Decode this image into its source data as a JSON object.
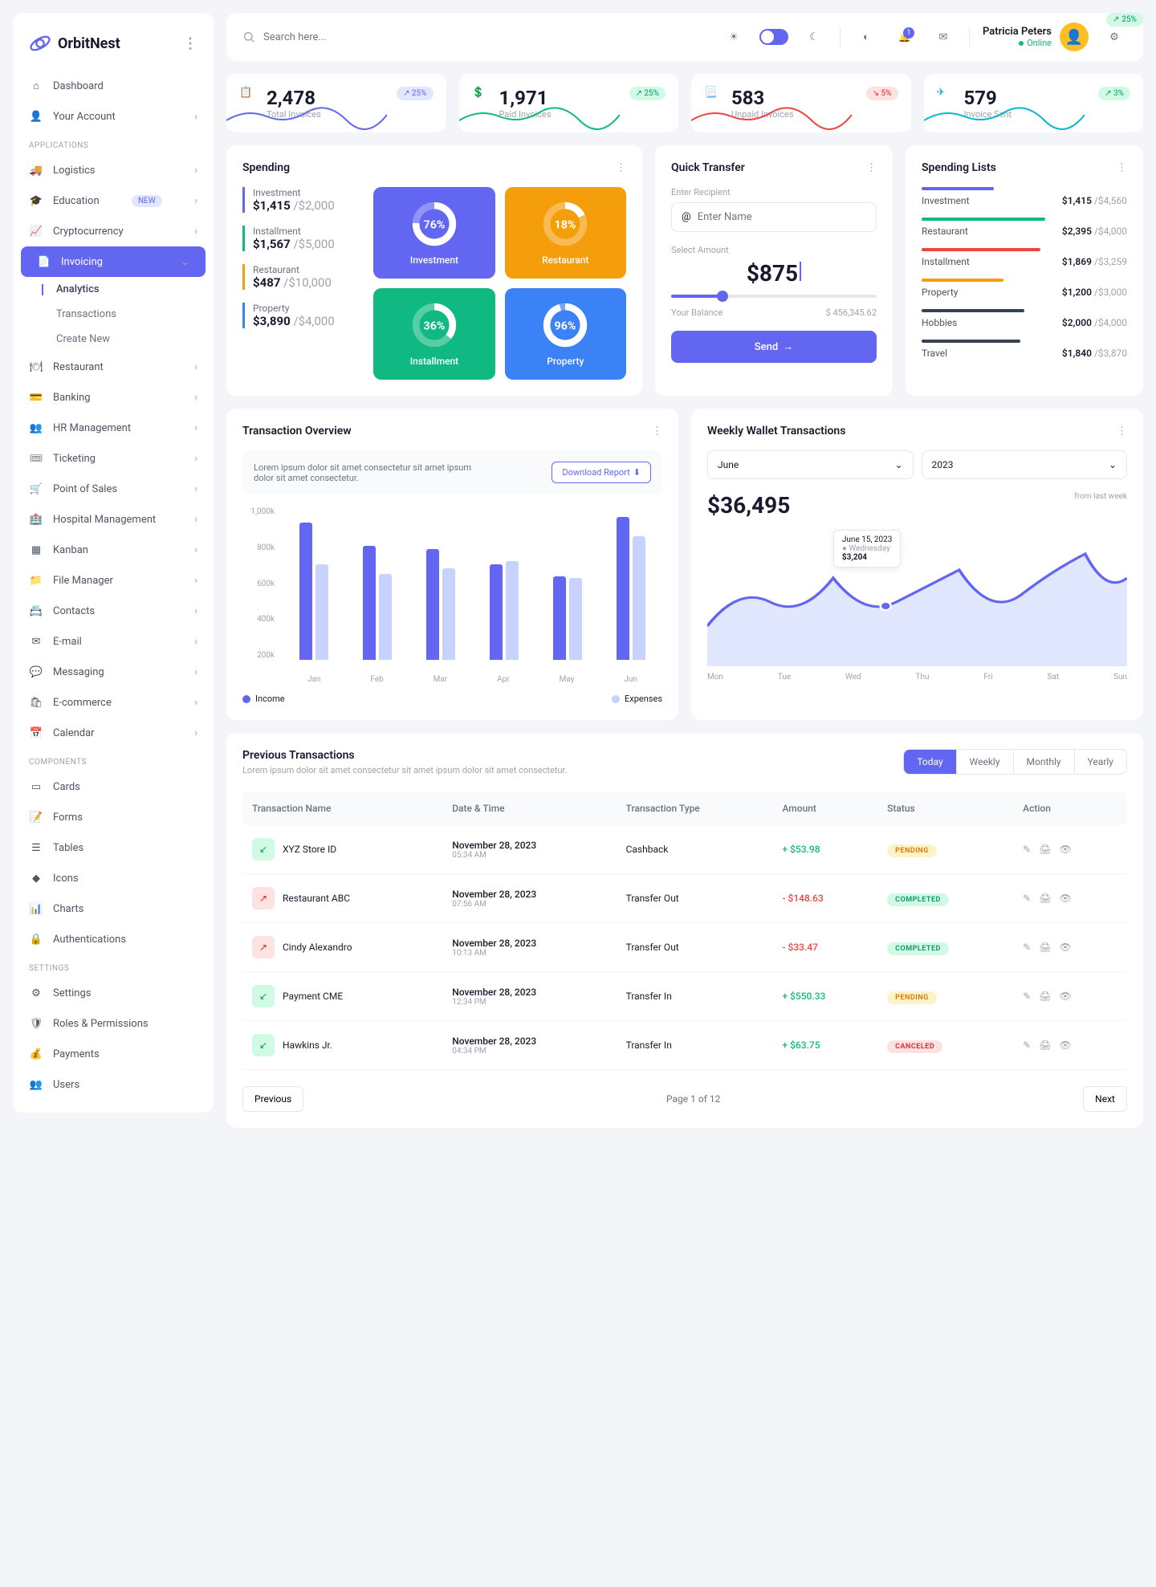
{
  "brand": "OrbitNest",
  "search": {
    "placeholder": "Search here..."
  },
  "user": {
    "name": "Patricia Peters",
    "status": "Online"
  },
  "notif_count": "1",
  "sections": {
    "main": [
      {
        "label": "Dashboard"
      },
      {
        "label": "Your Account"
      }
    ],
    "apps_label": "APPLICATIONS",
    "apps": [
      {
        "label": "Logistics"
      },
      {
        "label": "Education",
        "badge": "NEW"
      },
      {
        "label": "Cryptocurrency"
      },
      {
        "label": "Invoicing",
        "active": true
      },
      {
        "label": "Restaurant"
      },
      {
        "label": "Banking"
      },
      {
        "label": "HR Management"
      },
      {
        "label": "Ticketing"
      },
      {
        "label": "Point of Sales"
      },
      {
        "label": "Hospital Management"
      },
      {
        "label": "Kanban"
      },
      {
        "label": "File Manager"
      },
      {
        "label": "Contacts"
      },
      {
        "label": "E-mail"
      },
      {
        "label": "Messaging"
      },
      {
        "label": "E-commerce"
      },
      {
        "label": "Calendar"
      }
    ],
    "invoicing_sub": [
      {
        "label": "Analytics",
        "active": true
      },
      {
        "label": "Transactions"
      },
      {
        "label": "Create New"
      }
    ],
    "components_label": "COMPONENTS",
    "components": [
      {
        "label": "Cards"
      },
      {
        "label": "Forms"
      },
      {
        "label": "Tables"
      },
      {
        "label": "Icons"
      },
      {
        "label": "Charts"
      },
      {
        "label": "Authentications"
      }
    ],
    "settings_label": "SETTINGS",
    "settings": [
      {
        "label": "Settings"
      },
      {
        "label": "Roles & Permissions"
      },
      {
        "label": "Payments"
      },
      {
        "label": "Users"
      }
    ]
  },
  "stats": [
    {
      "value": "2,478",
      "label": "Total Invoices",
      "badge": "25%",
      "dir": "info",
      "color": "#6366f1"
    },
    {
      "value": "1,971",
      "label": "Paid Invoices",
      "badge": "25%",
      "dir": "up",
      "color": "#10b981"
    },
    {
      "value": "583",
      "label": "Unpaid Invoices",
      "badge": "5%",
      "dir": "down",
      "color": "#ef4444"
    },
    {
      "value": "579",
      "label": "Invoice Sent",
      "badge": "3%",
      "dir": "up",
      "color": "#06b6d4"
    }
  ],
  "spending": {
    "title": "Spending",
    "items": [
      {
        "label": "Investment",
        "val": "$1,415",
        "max": "/$2,000",
        "pct": "76%"
      },
      {
        "label": "Installment",
        "val": "$1,567",
        "max": "/$5,000",
        "pct": "36%"
      },
      {
        "label": "Restaurant",
        "val": "$487",
        "max": "/$10,000",
        "pct": "18%"
      },
      {
        "label": "Property",
        "val": "$3,890",
        "max": "/$4,000",
        "pct": "96%"
      }
    ]
  },
  "quick_transfer": {
    "title": "Quick Transfer",
    "recipient_label": "Enter Recipient",
    "recipient_placeholder": "Enter Name",
    "amount_label": "Select Amount",
    "amount": "$875",
    "balance_label": "Your Balance",
    "balance": "$ 456,345.62",
    "send": "Send"
  },
  "spending_lists": {
    "title": "Spending Lists",
    "items": [
      {
        "name": "Investment",
        "val": "$1,415",
        "max": "/$4,560",
        "color": "#6366f1",
        "w": "35%"
      },
      {
        "name": "Restaurant",
        "val": "$2,395",
        "max": "/$4,000",
        "color": "#10b981",
        "w": "60%"
      },
      {
        "name": "Installment",
        "val": "$1,869",
        "max": "/$3,259",
        "color": "#ef4444",
        "w": "58%"
      },
      {
        "name": "Property",
        "val": "$1,200",
        "max": "/$3,000",
        "color": "#f59e0b",
        "w": "40%"
      },
      {
        "name": "Hobbies",
        "val": "$2,000",
        "max": "/$4,000",
        "color": "#374151",
        "w": "50%"
      },
      {
        "name": "Travel",
        "val": "$1,840",
        "max": "/$3,870",
        "color": "#374151",
        "w": "48%"
      }
    ]
  },
  "transaction_overview": {
    "title": "Transaction Overview",
    "note": "Lorem ipsum dolor sit amet consectetur sit amet ipsum dolor sit amet consectetur.",
    "download": "Download Report",
    "legend_income": "Income",
    "legend_expense": "Expenses"
  },
  "weekly_wallet": {
    "title": "Weekly Wallet Transactions",
    "month": "June",
    "year": "2023",
    "amount": "$36,495",
    "badge": "25%",
    "sub": "from last week",
    "tooltip_date": "June 15, 2023",
    "tooltip_day": "Wednesday",
    "tooltip_val": "$3,204",
    "days": [
      "Mon",
      "Tue",
      "Wed",
      "Thu",
      "Fri",
      "Sat",
      "Sun"
    ]
  },
  "previous_transactions": {
    "title": "Previous Transactions",
    "sub": "Lorem ipsum dolor sit amet consectetur sit amet ipsum dolor sit amet consectetur.",
    "tabs": [
      "Today",
      "Weekly",
      "Monthly",
      "Yearly"
    ],
    "headers": [
      "Transaction Name",
      "Date & Time",
      "Transaction Type",
      "Amount",
      "Status",
      "Action"
    ],
    "rows": [
      {
        "icon": "in",
        "name": "XYZ Store ID",
        "date": "November 28, 2023",
        "time": "05:34 AM",
        "type": "Cashback",
        "amount": "+ $53.98",
        "amt_class": "pos",
        "status": "PENDING",
        "status_class": "pending"
      },
      {
        "icon": "out",
        "name": "Restaurant ABC",
        "date": "November 28, 2023",
        "time": "07:56 AM",
        "type": "Transfer Out",
        "amount": "- $148.63",
        "amt_class": "neg",
        "status": "COMPLETED",
        "status_class": "completed"
      },
      {
        "icon": "out",
        "name": "Cindy Alexandro",
        "date": "November 28, 2023",
        "time": "10:13 AM",
        "type": "Transfer Out",
        "amount": "- $33.47",
        "amt_class": "neg",
        "status": "COMPLETED",
        "status_class": "completed"
      },
      {
        "icon": "in",
        "name": "Payment CME",
        "date": "November 28, 2023",
        "time": "12:34 PM",
        "type": "Transfer In",
        "amount": "+ $550.33",
        "amt_class": "pos",
        "status": "PENDING",
        "status_class": "pending"
      },
      {
        "icon": "in",
        "name": "Hawkins Jr.",
        "date": "November 28, 2023",
        "time": "04:34 PM",
        "type": "Transfer In",
        "amount": "+ $63.75",
        "amt_class": "pos",
        "status": "CANCELED",
        "status_class": "canceled"
      }
    ],
    "prev": "Previous",
    "page": "Page 1 of 12",
    "next": "Next"
  },
  "chart_data": {
    "transaction_overview": {
      "type": "bar",
      "categories": [
        "Jan",
        "Feb",
        "Mar",
        "Apr",
        "May",
        "Jun"
      ],
      "series": [
        {
          "name": "Income",
          "values": [
            920,
            800,
            780,
            700,
            640,
            950
          ]
        },
        {
          "name": "Expenses",
          "values": [
            700,
            650,
            680,
            720,
            630,
            850
          ]
        }
      ],
      "ylabels": [
        "1,000k",
        "800k",
        "600k",
        "400k",
        "200k"
      ],
      "ylim": [
        200,
        1000
      ]
    },
    "weekly_wallet": {
      "type": "line",
      "categories": [
        "Mon",
        "Tue",
        "Wed",
        "Thu",
        "Fri",
        "Sat",
        "Sun"
      ],
      "values": [
        3100,
        3600,
        3204,
        3800,
        5200,
        4100,
        4800
      ]
    },
    "spending_donuts": [
      {
        "label": "Investment",
        "pct": 76
      },
      {
        "label": "Installment",
        "pct": 36
      },
      {
        "label": "Restaurant",
        "pct": 18
      },
      {
        "label": "Property",
        "pct": 96
      }
    ]
  }
}
